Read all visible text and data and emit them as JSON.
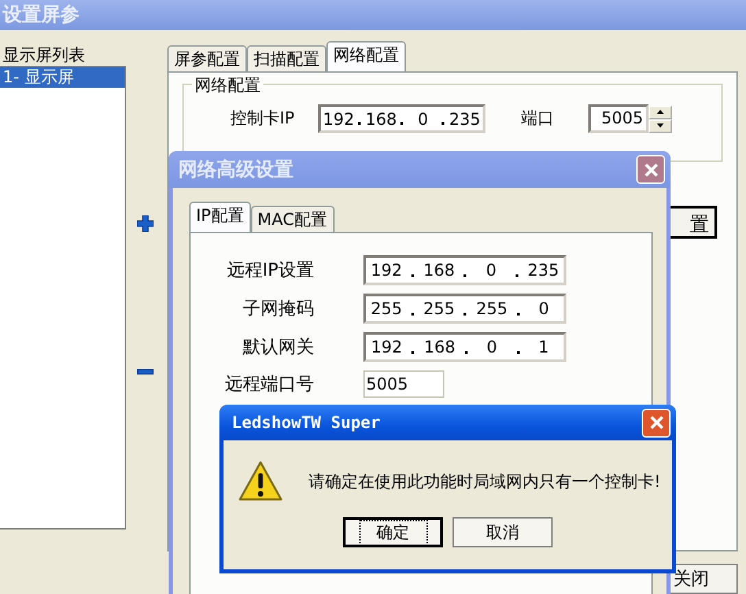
{
  "main_window": {
    "title": "设置屏参",
    "list_label": "显示屏列表",
    "list_items": [
      {
        "label": "1- 显示屏",
        "selected": true
      }
    ],
    "tabs": [
      {
        "label": "屏参配置",
        "selected": false
      },
      {
        "label": "扫描配置",
        "selected": false
      },
      {
        "label": "网络配置",
        "selected": true
      }
    ],
    "group": {
      "title": "网络配置",
      "ip_label": "控制卡IP",
      "ip": [
        "192",
        "168",
        "0",
        "235"
      ],
      "port_label": "端口",
      "port": "5005"
    },
    "partial_button": "置",
    "close_button": "关闭"
  },
  "network_dialog": {
    "title": "网络高级设置",
    "tabs": [
      {
        "label": "IP配置",
        "selected": true
      },
      {
        "label": "MAC配置",
        "selected": false
      }
    ],
    "fields": [
      {
        "label": "远程IP设置",
        "kind": "ip",
        "octets": [
          "192",
          "168",
          "0",
          "235"
        ]
      },
      {
        "label": "子网掩码",
        "kind": "ip",
        "octets": [
          "255",
          "255",
          "255",
          "0"
        ]
      },
      {
        "label": "默认网关",
        "kind": "ip",
        "octets": [
          "192",
          "168",
          "0",
          "1"
        ]
      },
      {
        "label": "远程端口号",
        "kind": "text",
        "value": "5005"
      }
    ]
  },
  "message_box": {
    "title": "LedshowTW Super",
    "message": "请确定在使用此功能时局域网内只有一个控制卡!",
    "buttons": [
      {
        "label": "确定",
        "focused": true
      },
      {
        "label": "取消",
        "focused": false
      }
    ]
  }
}
